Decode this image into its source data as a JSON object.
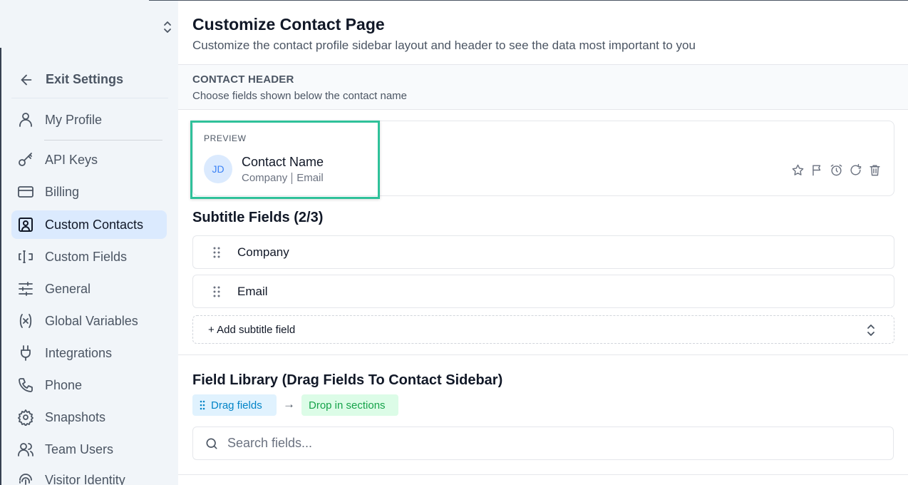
{
  "sidebar": {
    "exit_label": "Exit Settings",
    "items": [
      {
        "label": "My Profile",
        "icon": "user-icon",
        "active": false
      },
      {
        "label": "API Keys",
        "icon": "key-icon",
        "active": false
      },
      {
        "label": "Billing",
        "icon": "credit-card-icon",
        "active": false
      },
      {
        "label": "Custom Contacts",
        "icon": "contact-card-icon",
        "active": true
      },
      {
        "label": "Custom Fields",
        "icon": "text-cursor-input-icon",
        "active": false
      },
      {
        "label": "General",
        "icon": "sliders-icon",
        "active": false
      },
      {
        "label": "Global Variables",
        "icon": "variable-icon",
        "active": false
      },
      {
        "label": "Integrations",
        "icon": "plug-icon",
        "active": false
      },
      {
        "label": "Phone",
        "icon": "phone-icon",
        "active": false
      },
      {
        "label": "Snapshots",
        "icon": "gear-icon",
        "active": false
      },
      {
        "label": "Team Users",
        "icon": "users-icon",
        "active": false
      },
      {
        "label": "Visitor Identity",
        "icon": "fingerprint-icon",
        "active": false
      }
    ]
  },
  "page": {
    "title": "Customize Contact Page",
    "subtitle": "Customize the contact profile sidebar layout and header to see the data most important to you"
  },
  "contact_header": {
    "title": "CONTACT HEADER",
    "subtitle": "Choose fields shown below the contact name"
  },
  "preview": {
    "label": "PREVIEW",
    "initials": "JD",
    "name": "Contact Name",
    "sub_field_1": "Company",
    "sub_field_2": "Email",
    "action_icons": [
      "star-icon",
      "flag-icon",
      "alarm-clock-icon",
      "rotate-icon",
      "trash-icon"
    ]
  },
  "subtitle_fields": {
    "title": "Subtitle Fields (2/3)",
    "items": [
      "Company",
      "Email"
    ],
    "add_label": "+ Add subtitle field"
  },
  "field_library": {
    "title": "Field Library (Drag Fields To Contact Sidebar)",
    "drag_pill": "Drag fields",
    "arrow": "→",
    "drop_pill": "Drop in sections",
    "search_placeholder": "Search fields..."
  },
  "colors": {
    "accent": "#2fc19a",
    "active_bg": "#dbeafe",
    "sidebar_bg": "#f1f5f9"
  }
}
